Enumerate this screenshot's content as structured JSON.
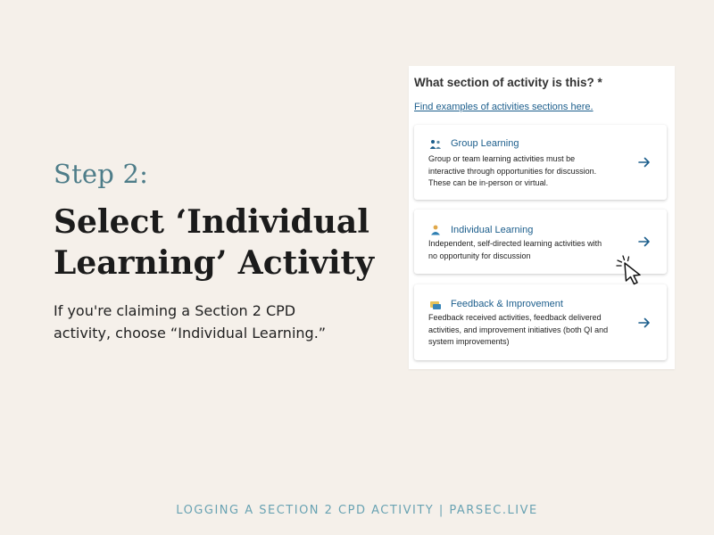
{
  "slide": {
    "step_label": "Step 2:",
    "headline_line1": "Select ‘Individual",
    "headline_line2": "Learning’ Activity",
    "body": "If you're claiming a Section 2 CPD activity, choose “Individual Learning.”",
    "footer": "LOGGING A SECTION 2 CPD ACTIVITY | PARSEC.LIVE"
  },
  "form": {
    "question": "What section of activity is this? *",
    "link": "Find examples of activities sections here.",
    "options": [
      {
        "title": "Group Learning",
        "desc_lines": [
          "Group or team learning activities must be",
          "interactive through opportunities for discussion.",
          "These can be in-person or virtual."
        ],
        "icon": "group-icon"
      },
      {
        "title": "Individual Learning",
        "desc_lines": [
          "Independent, self-directed learning activities with",
          "no opportunity for discussion"
        ],
        "icon": "person-icon"
      },
      {
        "title": "Feedback & Improvement",
        "desc_lines": [
          "Feedback received activities, feedback delivered",
          "activities, and improvement initiatives (both QI and",
          "system improvements)"
        ],
        "icon": "feedback-icon"
      }
    ]
  },
  "colors": {
    "background": "#f5f0ea",
    "accent_teal": "#4e7d89",
    "footer_teal": "#6aa3b3",
    "link_blue": "#1c5e8c",
    "headline": "#1b1b1b"
  },
  "icons": {
    "option_arrow": "arrow-right-icon",
    "pointer": "pointer-cursor-icon"
  }
}
